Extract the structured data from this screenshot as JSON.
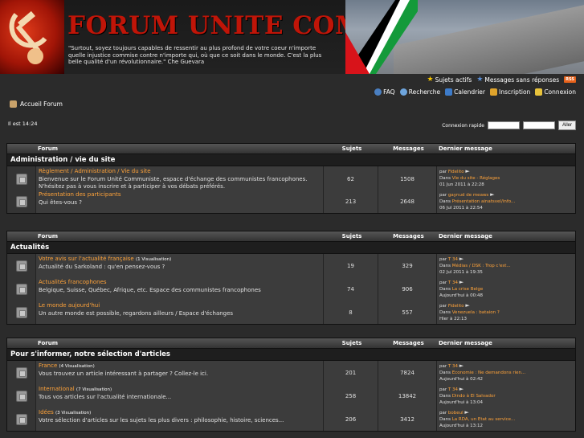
{
  "header": {
    "site_title": "FORUM UNITE COMMUNISTE",
    "quote": "\"Surtout, soyez toujours capables  de ressentir au plus profond de votre coeur  n'importe quelle injustice commise contre n'importe qui, où que ce soit dans le monde. C'est la plus belle qualité d'un révolutionnaire.\" Che Guevara"
  },
  "toplinks": {
    "active": "Sujets actifs",
    "unanswered": "Messages sans réponses",
    "rss": "RSS",
    "faq": "FAQ",
    "search": "Recherche",
    "calendar": "Calendrier",
    "register": "Inscription",
    "login": "Connexion"
  },
  "breadcrumb": "Accueil Forum",
  "time": "Il est 14:24",
  "quick_login": {
    "label": "Connexion rapide",
    "button": "Aller"
  },
  "columns": {
    "forum": "Forum",
    "topics": "Sujets",
    "messages": "Messages",
    "last": "Dernier message"
  },
  "categories": [
    {
      "title": "Administration / vie du site",
      "forums": [
        {
          "name": "Règlement / Administration / Vie du site",
          "vis": "",
          "desc": "Bienvenue sur le Forum Unité Communiste, espace d'échange des communistes francophones. N'hésitez pas à vous inscrire et à participer à vos débats préférés.",
          "topics": "62",
          "messages": "1508",
          "by": "Fidelito",
          "in": "Vie du site - Réglages",
          "date": "01 Jun 2011 à 22:28"
        },
        {
          "name": "Présentation des participants",
          "vis": "",
          "desc": "Qui êtes-vous ?",
          "topics": "213",
          "messages": "2648",
          "by": "gaynud de meaws",
          "in": "Présentation ainatsvel/info...",
          "date": "06 Jul 2011 à 22:54"
        }
      ]
    },
    {
      "title": "Actualités",
      "forums": [
        {
          "name": "Votre avis sur l'actualité française",
          "vis": "(1 Visualisation)",
          "desc": "Actualité du Sarkoland : qu'en pensez-vous ?",
          "topics": "19",
          "messages": "329",
          "by": "T 34",
          "in": "Médias / DSK : Trop c'est...",
          "date": "02 Jul 2011 à 19:35"
        },
        {
          "name": "Actualités francophones",
          "vis": "",
          "desc": "Belgique, Suisse, Québec, Afrique, etc. Espace des communistes francophones",
          "topics": "74",
          "messages": "906",
          "by": "T 34",
          "in": "La crise Belge",
          "date": "Aujourd'hui à 00:48"
        },
        {
          "name": "Le monde aujourd'hui",
          "vis": "",
          "desc": "Un autre monde est possible, regardons ailleurs / Espace d'échanges",
          "topics": "8",
          "messages": "557",
          "by": "Fidelito",
          "in": "Venezuela : bataion ?",
          "date": "Hier à 22:13"
        }
      ]
    },
    {
      "title": "Pour s'informer, notre sélection d'articles",
      "forums": [
        {
          "name": "France",
          "vis": "(4 Visualisation)",
          "desc": "Vous trouvez un article intéressant à partager ? Collez-le ici.",
          "topics": "201",
          "messages": "7824",
          "by": "T 34",
          "in": "Economie : Ne demandons rien...",
          "date": "Aujourd'hui à 02:42"
        },
        {
          "name": "International",
          "vis": "(7 Visualisation)",
          "desc": "Tous vos articles sur l'actualité internationale...",
          "topics": "258",
          "messages": "13842",
          "by": "T 34",
          "in": "Dindo à El Salvador",
          "date": "Aujourd'hui à 13:04"
        },
        {
          "name": "Idées",
          "vis": "(3 Visualisation)",
          "desc": "Votre sélection d'articles sur les sujets les plus divers : philosophie, histoire, sciences...",
          "topics": "206",
          "messages": "3412",
          "by": "bobeul",
          "in": "La RDA, un Etat au service...",
          "date": "Aujourd'hui à 13:12"
        }
      ]
    }
  ]
}
